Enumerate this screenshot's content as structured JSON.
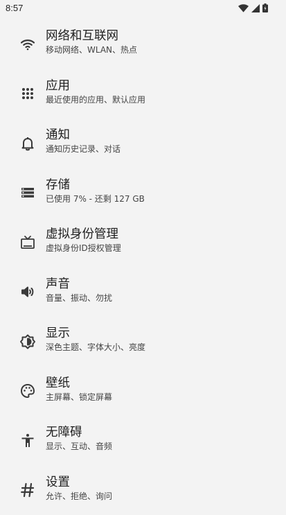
{
  "status_bar": {
    "time": "8:57",
    "icons": [
      "wifi-icon",
      "cell-signal-icon",
      "battery-icon"
    ]
  },
  "settings": [
    {
      "icon": "wifi-icon",
      "title": "网络和互联网",
      "summary": "移动网络、WLAN、热点"
    },
    {
      "icon": "apps-grid-icon",
      "title": "应用",
      "summary": "最近使用的应用、默认应用"
    },
    {
      "icon": "bell-icon",
      "title": "通知",
      "summary": "通知历史记录、对话"
    },
    {
      "icon": "storage-icon",
      "title": "存储",
      "summary": "已使用 7% - 还剩 127 GB"
    },
    {
      "icon": "tv-icon",
      "title": "虚拟身份管理",
      "summary": "虚拟身份ID授权管理"
    },
    {
      "icon": "volume-icon",
      "title": "声音",
      "summary": "音量、振动、勿扰"
    },
    {
      "icon": "brightness-icon",
      "title": "显示",
      "summary": "深色主题、字体大小、亮度"
    },
    {
      "icon": "palette-icon",
      "title": "壁纸",
      "summary": "主屏幕、锁定屏幕"
    },
    {
      "icon": "accessibility-icon",
      "title": "无障碍",
      "summary": "显示、互动、音频"
    },
    {
      "icon": "hash-icon",
      "title": "设置",
      "summary": "允许、拒绝、询问"
    }
  ]
}
